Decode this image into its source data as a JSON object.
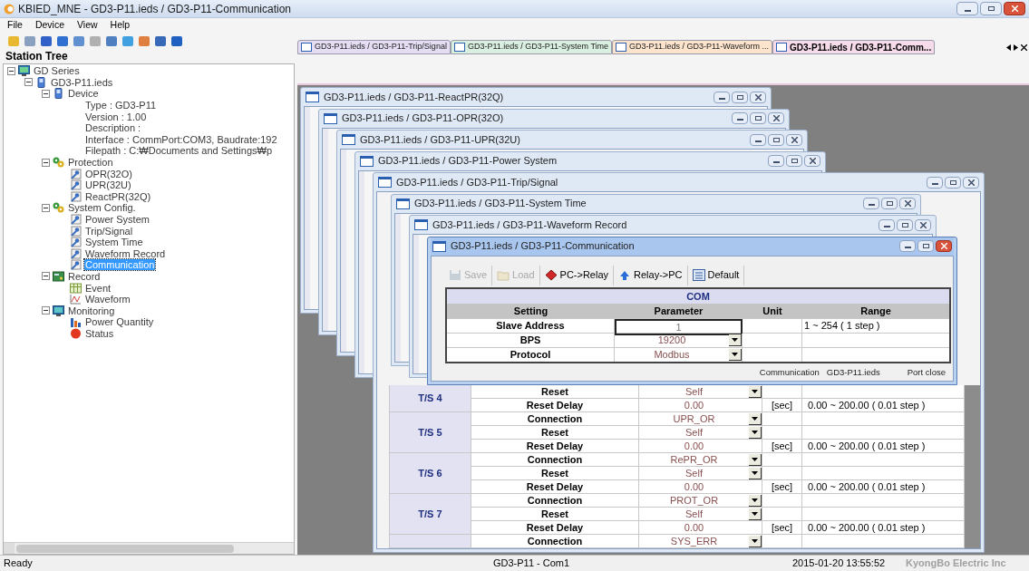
{
  "window": {
    "title": "KBIED_MNE - GD3-P11.ieds / GD3-P11-Communication"
  },
  "menu": [
    "File",
    "Device",
    "View",
    "Help"
  ],
  "station_tree": {
    "title": "Station Tree",
    "items": [
      {
        "label": "GD Series",
        "kind": "station",
        "expanded": true,
        "selected": false,
        "children": [
          {
            "label": "GD3-P11.ieds",
            "kind": "device",
            "expanded": true,
            "selected": false,
            "children": [
              {
                "label": "Device",
                "kind": "device",
                "expanded": true,
                "selected": false,
                "children": [
                  {
                    "label": "Type : GD3-P11",
                    "kind": "info",
                    "selected": false
                  },
                  {
                    "label": "Version : 1.00",
                    "kind": "info",
                    "selected": false
                  },
                  {
                    "label": "Description :",
                    "kind": "info",
                    "selected": false
                  },
                  {
                    "label": "Interface : CommPort:COM3, Baudrate:192",
                    "kind": "info",
                    "selected": false
                  },
                  {
                    "label": "Filepath : C:₩Documents and Settings₩p",
                    "kind": "info",
                    "selected": false
                  }
                ]
              },
              {
                "label": "Protection",
                "kind": "gears",
                "expanded": true,
                "selected": false,
                "children": [
                  {
                    "label": "OPR(32O)",
                    "kind": "setting",
                    "selected": false
                  },
                  {
                    "label": "UPR(32U)",
                    "kind": "setting",
                    "selected": false
                  },
                  {
                    "label": "ReactPR(32Q)",
                    "kind": "setting",
                    "selected": false
                  }
                ]
              },
              {
                "label": "System Config.",
                "kind": "gears",
                "expanded": true,
                "selected": false,
                "children": [
                  {
                    "label": "Power System",
                    "kind": "setting",
                    "selected": false
                  },
                  {
                    "label": "Trip/Signal",
                    "kind": "setting",
                    "selected": false
                  },
                  {
                    "label": "System Time",
                    "kind": "setting",
                    "selected": false
                  },
                  {
                    "label": "Waveform Record",
                    "kind": "setting",
                    "selected": false
                  },
                  {
                    "label": "Communication",
                    "kind": "setting",
                    "selected": true
                  }
                ]
              },
              {
                "label": "Record",
                "kind": "record",
                "expanded": true,
                "selected": false,
                "children": [
                  {
                    "label": "Event",
                    "kind": "event",
                    "selected": false
                  },
                  {
                    "label": "Waveform",
                    "kind": "waveform",
                    "selected": false
                  }
                ]
              },
              {
                "label": "Monitoring",
                "kind": "monitor",
                "expanded": true,
                "selected": false,
                "children": [
                  {
                    "label": "Power Quantity",
                    "kind": "chart",
                    "selected": false
                  },
                  {
                    "label": "Status",
                    "kind": "status",
                    "selected": false
                  }
                ]
              }
            ]
          }
        ]
      }
    ]
  },
  "tabs": [
    {
      "label": "GD3-P11.ieds / GD3-P11-Trip/Signal",
      "color": "#e4ddf4",
      "selected": false
    },
    {
      "label": "GD3-P11.ieds / GD3-P11-System Time",
      "color": "#d9efdf",
      "selected": false
    },
    {
      "label": "GD3-P11.ieds / GD3-P11-Waveform ...",
      "color": "#fbe3cc",
      "selected": false
    },
    {
      "label": "GD3-P11.ieds / GD3-P11-Comm...",
      "color": "#f6dcea",
      "selected": true
    }
  ],
  "windows": [
    {
      "title": "GD3-P11.ieds / GD3-P11-ReactPR(32Q)",
      "kind": "empty",
      "active": false
    },
    {
      "title": "GD3-P11.ieds / GD3-P11-OPR(32O)",
      "kind": "empty",
      "active": false
    },
    {
      "title": "GD3-P11.ieds / GD3-P11-UPR(32U)",
      "kind": "empty",
      "active": false
    },
    {
      "title": "GD3-P11.ieds / GD3-P11-Power System",
      "kind": "empty",
      "active": false
    },
    {
      "title": "GD3-P11.ieds / GD3-P11-Trip/Signal",
      "kind": "trip_table",
      "active": false,
      "groups": [
        {
          "label": "T/S 4",
          "rows": [
            {
              "setting": "Reset",
              "value": "Self",
              "kind": "dropdown"
            },
            {
              "setting": "Reset Delay",
              "value": "0.00",
              "kind": "number",
              "unit": "[sec]",
              "range": "0.00 ~ 200.00 ( 0.01 step )"
            }
          ]
        },
        {
          "label": "T/S 5",
          "rows": [
            {
              "setting": "Connection",
              "value": "UPR_OR",
              "kind": "dropdown"
            },
            {
              "setting": "Reset",
              "value": "Self",
              "kind": "dropdown"
            },
            {
              "setting": "Reset Delay",
              "value": "0.00",
              "kind": "number",
              "unit": "[sec]",
              "range": "0.00 ~ 200.00 ( 0.01 step )"
            }
          ]
        },
        {
          "label": "T/S 6",
          "rows": [
            {
              "setting": "Connection",
              "value": "RePR_OR",
              "kind": "dropdown"
            },
            {
              "setting": "Reset",
              "value": "Self",
              "kind": "dropdown"
            },
            {
              "setting": "Reset Delay",
              "value": "0.00",
              "kind": "number",
              "unit": "[sec]",
              "range": "0.00 ~ 200.00 ( 0.01 step )"
            }
          ]
        },
        {
          "label": "T/S 7",
          "rows": [
            {
              "setting": "Connection",
              "value": "PROT_OR",
              "kind": "dropdown"
            },
            {
              "setting": "Reset",
              "value": "Self",
              "kind": "dropdown"
            },
            {
              "setting": "Reset Delay",
              "value": "0.00",
              "kind": "number",
              "unit": "[sec]",
              "range": "0.00 ~ 200.00 ( 0.01 step )"
            }
          ]
        },
        {
          "rows": [
            {
              "setting": "Connection",
              "value": "SYS_ERR",
              "kind": "dropdown"
            }
          ]
        }
      ]
    },
    {
      "title": "GD3-P11.ieds / GD3-P11-System Time",
      "kind": "empty",
      "active": false
    },
    {
      "title": "GD3-P11.ieds / GD3-P11-Waveform Record",
      "kind": "empty",
      "active": false
    },
    {
      "title": "GD3-P11.ieds / GD3-P11-Communication",
      "kind": "settings_form",
      "active": true,
      "toolbar": [
        {
          "label": "Save",
          "kind": "save",
          "disabled": true
        },
        {
          "label": "Load",
          "kind": "load",
          "disabled": true
        },
        {
          "label": "PC->Relay",
          "kind": "to_relay",
          "disabled": false
        },
        {
          "label": "Relay->PC",
          "kind": "to_pc",
          "disabled": false
        },
        {
          "label": "Default",
          "kind": "default",
          "disabled": false
        }
      ],
      "table": {
        "title": "COM",
        "columns": [
          "Setting",
          "Parameter",
          "Unit",
          "Range"
        ],
        "rows": [
          {
            "setting": "Slave Address",
            "value": "1",
            "kind": "input",
            "focused": true,
            "range": "1 ~ 254 ( 1 step )"
          },
          {
            "setting": "BPS",
            "value": "19200",
            "kind": "dropdown",
            "focused": false
          },
          {
            "setting": "Protocol",
            "value": "Modbus",
            "kind": "dropdown",
            "focused": false
          }
        ]
      },
      "status": [
        "Communication",
        "GD3-P11.ieds",
        "Port close"
      ]
    }
  ],
  "status_bar": {
    "message": "Ready",
    "connection": "GD3-P11 - Com1",
    "datetime": "2015-01-20 13:55:52",
    "company": "KyongBo Electric Inc"
  }
}
